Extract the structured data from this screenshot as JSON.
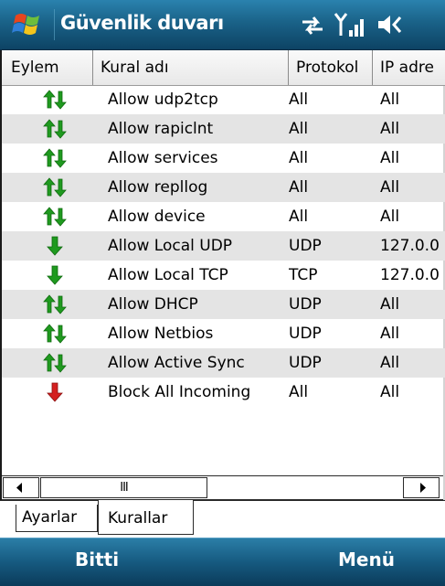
{
  "window": {
    "title": "Güvenlik duvarı"
  },
  "status_icons": [
    "connectivity-icon",
    "signal-strength-icon",
    "volume-icon"
  ],
  "columns": {
    "action": "Eylem",
    "rule_name": "Kural adı",
    "protocol": "Protokol",
    "ip_address": "IP adre"
  },
  "rules": [
    {
      "icon": "bidirectional-arrows-icon",
      "name": "Allow udp2tcp",
      "protocol": "All",
      "ip": "All"
    },
    {
      "icon": "bidirectional-arrows-icon",
      "name": "Allow rapiclnt",
      "protocol": "All",
      "ip": "All"
    },
    {
      "icon": "bidirectional-arrows-icon",
      "name": "Allow services",
      "protocol": "All",
      "ip": "All"
    },
    {
      "icon": "bidirectional-arrows-icon",
      "name": "Allow repllog",
      "protocol": "All",
      "ip": "All"
    },
    {
      "icon": "bidirectional-arrows-icon",
      "name": "Allow device",
      "protocol": "All",
      "ip": "All"
    },
    {
      "icon": "down-arrow-allow-icon",
      "name": "Allow Local UDP",
      "protocol": "UDP",
      "ip": "127.0.0"
    },
    {
      "icon": "down-arrow-allow-icon",
      "name": "Allow Local TCP",
      "protocol": "TCP",
      "ip": "127.0.0"
    },
    {
      "icon": "bidirectional-arrows-icon",
      "name": "Allow DHCP",
      "protocol": "UDP",
      "ip": "All"
    },
    {
      "icon": "bidirectional-arrows-icon",
      "name": "Allow Netbios",
      "protocol": "UDP",
      "ip": "All"
    },
    {
      "icon": "bidirectional-arrows-icon",
      "name": "Allow Active Sync",
      "protocol": "UDP",
      "ip": "All"
    },
    {
      "icon": "down-arrow-block-icon",
      "name": "Block All Incoming",
      "protocol": "All",
      "ip": "All"
    }
  ],
  "scrollbar": {
    "thumb_label": "III"
  },
  "tabs": [
    {
      "label": "Ayarlar",
      "selected": false
    },
    {
      "label": "Kurallar",
      "selected": true
    }
  ],
  "softkeys": {
    "left": "Bitti",
    "right": "Menü"
  },
  "colors": {
    "titlebar": "#1a6288",
    "softbar": "#165a80",
    "allow_green": "#1f9a1f",
    "block_red": "#d42020",
    "alt_row": "#e4e4e4"
  }
}
